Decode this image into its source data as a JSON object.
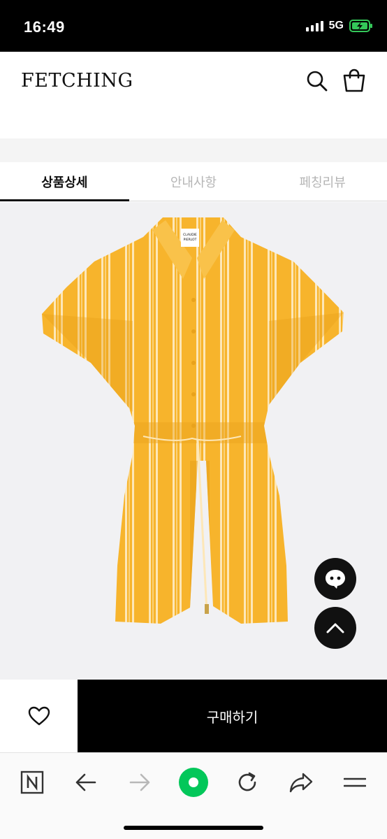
{
  "status_bar": {
    "time": "16:49",
    "network": "5G",
    "battery_charging": true,
    "battery_color": "#34c759"
  },
  "header": {
    "logo": "FETCHING",
    "search_icon": "search-icon",
    "bag_icon": "shopping-bag-icon"
  },
  "tabs": [
    {
      "label": "상품상세",
      "active": true
    },
    {
      "label": "안내사항",
      "active": false
    },
    {
      "label": "페칭리뷰",
      "active": false
    }
  ],
  "product": {
    "brand_tag": "CLAUDIE PIERLOT",
    "garment_color": "#f7b42c",
    "stripe_color": "#fde7b8"
  },
  "floating": {
    "chat_icon": "chat-icon",
    "top_icon": "chevron-up-icon"
  },
  "purchase": {
    "wishlist_icon": "heart-icon",
    "buy_label": "구매하기"
  },
  "browser": {
    "active_color": "#03c75a",
    "icons": [
      "naver-n-icon",
      "back-arrow-icon",
      "forward-arrow-icon",
      "home-dot-icon",
      "refresh-icon",
      "share-icon",
      "menu-icon"
    ]
  }
}
